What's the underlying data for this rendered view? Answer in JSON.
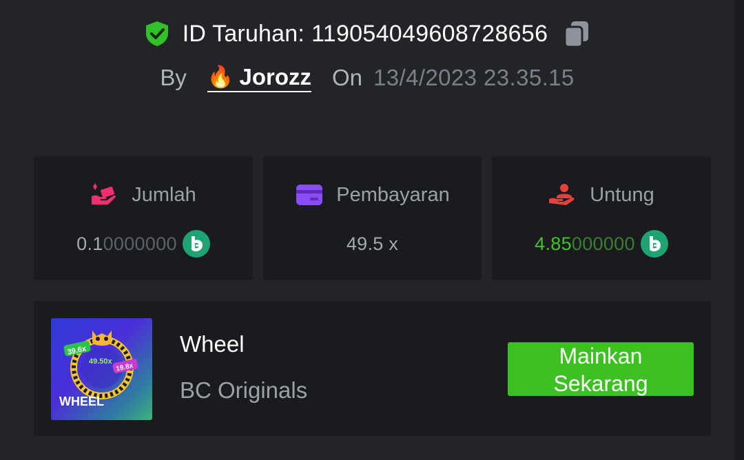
{
  "header": {
    "bet_id_label": "ID Taruhan:",
    "bet_id": "119054049608728656",
    "by_label": "By",
    "player_name": "Jorozz",
    "on_label": "On",
    "timestamp": "13/4/2023 23.35.15",
    "verified_icon": "shield-check-icon",
    "copy_icon": "copy-icon",
    "fire_icon": "fire-emoji"
  },
  "stats": {
    "amount": {
      "label": "Jumlah",
      "value_main": "0.1",
      "value_trailing": "0000000",
      "icon": "bet-hand-icon",
      "currency_icon": "bc-coin-icon"
    },
    "payout": {
      "label": "Pembayaran",
      "value": "49.5 x",
      "icon": "wallet-card-icon"
    },
    "profit": {
      "label": "Untung",
      "value_main": "4.85",
      "value_trailing": "000000",
      "icon": "profit-hand-icon",
      "currency_icon": "bc-coin-icon"
    }
  },
  "game": {
    "title": "Wheel",
    "provider": "BC Originals",
    "thumbnail_text": "WHEEL",
    "thumbnail_badges": [
      "39.6x",
      "49.50x",
      "19.8x"
    ],
    "play_button_line1": "Mainkan",
    "play_button_line2": "Sekarang"
  },
  "colors": {
    "background": "#232427",
    "card": "#1a1b1e",
    "accent_green": "#3dc021",
    "profit_green": "#45c12c",
    "coin_teal": "#20a372",
    "amount_pink": "#f0306e",
    "payout_purple": "#8a4cf7",
    "profit_red": "#e5403a"
  }
}
